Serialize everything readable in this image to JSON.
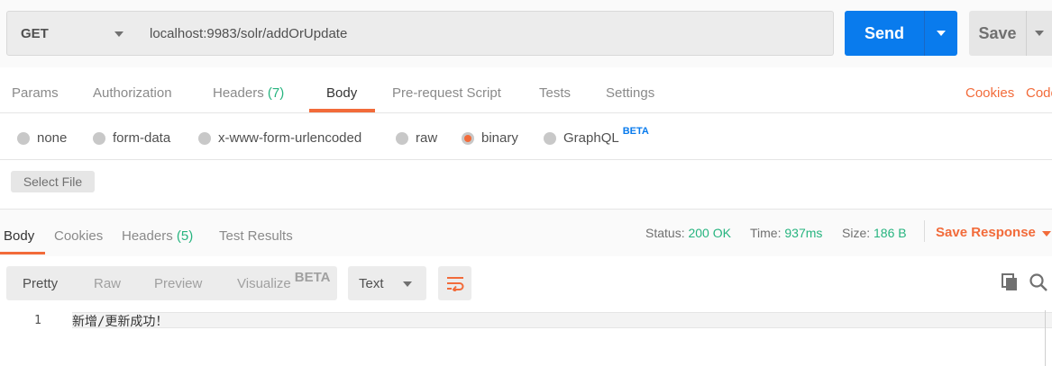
{
  "request": {
    "method": "GET",
    "url": "localhost:9983/solr/addOrUpdate",
    "send_label": "Send",
    "save_label": "Save"
  },
  "request_tabs": {
    "params": "Params",
    "authorization": "Authorization",
    "headers": "Headers",
    "headers_count": "(7)",
    "body": "Body",
    "prerequest": "Pre-request Script",
    "tests": "Tests",
    "settings": "Settings",
    "cookies": "Cookies",
    "code": "Code"
  },
  "body_types": {
    "none": "none",
    "form_data": "form-data",
    "urlencoded": "x-www-form-urlencoded",
    "raw": "raw",
    "binary": "binary",
    "graphql": "GraphQL",
    "graphql_badge": "BETA",
    "selected": "binary"
  },
  "file": {
    "select_label": "Select File"
  },
  "response_tabs": {
    "body": "Body",
    "cookies": "Cookies",
    "headers": "Headers",
    "headers_count": "(5)",
    "test_results": "Test Results"
  },
  "response_meta": {
    "status_label": "Status:",
    "status_value": "200 OK",
    "time_label": "Time:",
    "time_value": "937ms",
    "size_label": "Size:",
    "size_value": "186 B",
    "save_response": "Save Response"
  },
  "view_modes": {
    "pretty": "Pretty",
    "raw": "Raw",
    "preview": "Preview",
    "visualize": "Visualize",
    "visualize_badge": "BETA",
    "format": "Text"
  },
  "response_body": {
    "lines": [
      {
        "number": "1",
        "text": "新增/更新成功！"
      }
    ]
  },
  "colors": {
    "accent": "#f26b3a",
    "primary": "#097bed",
    "success": "#26b47f"
  },
  "icons": {
    "wrap": "wrap-lines-icon",
    "copy": "copy-icon",
    "search": "search-icon"
  }
}
